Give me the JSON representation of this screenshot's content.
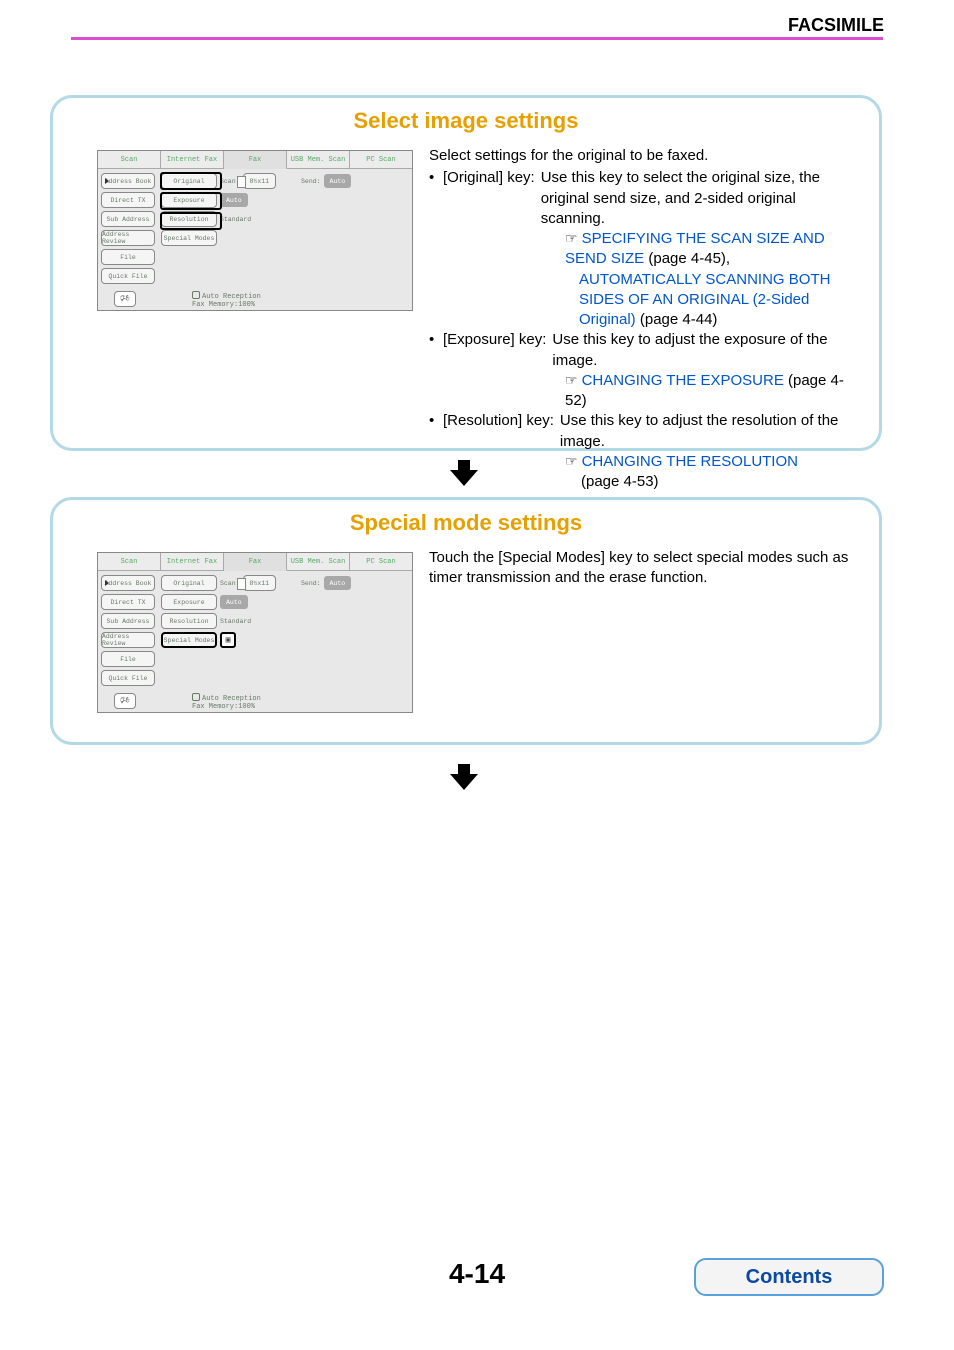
{
  "header": "FACSIMILE",
  "page_number": "4-14",
  "contents_button": "Contents",
  "tabs": [
    "Scan",
    "Internet Fax",
    "Fax",
    "USB Mem. Scan",
    "PC Scan"
  ],
  "side": {
    "address_book": "Address Book",
    "direct_tx": "Direct TX",
    "sub_address": "Sub Address",
    "address_review": "Address Review",
    "file": "File",
    "quick_file": "Quick File"
  },
  "settings": {
    "original": "Original",
    "scan": "Scan:",
    "scan_val": "8½x11",
    "send": "Send:",
    "send_val": "Auto",
    "exposure": "Exposure",
    "exposure_val": "Auto",
    "resolution": "Resolution",
    "resolution_val": "Standard",
    "special_modes": "Special Modes"
  },
  "status": {
    "line1": "Auto Reception",
    "line2": "Fax Memory:100%"
  },
  "panel1": {
    "title": "Select image settings",
    "intro": "Select settings for the original to be faxed.",
    "orig_key": "[Original] key:",
    "orig_txt": "Use this key to select the original size, the original send size, and 2-sided original scanning.",
    "link1": "SPECIFYING THE SCAN SIZE AND SEND SIZE",
    "link1_pg": " (page 4-45), ",
    "link2": "AUTOMATICALLY SCANNING BOTH SIDES OF AN ORIGINAL (2-Sided Original)",
    "link2_pg": " (page 4-44)",
    "exp_key": "[Exposure] key:",
    "exp_txt": "Use this key to adjust the exposure of the image.",
    "link3": "CHANGING THE EXPOSURE",
    "link3_pg": " (page 4-52)",
    "res_key": "[Resolution] key:",
    "res_txt": "Use this key to adjust the resolution of the image.",
    "link4": "CHANGING THE RESOLUTION",
    "link4_pg": "(page 4-53)"
  },
  "panel2": {
    "title": "Special mode settings",
    "text": "Touch the [Special Modes] key to select special modes such as timer transmission and the erase function."
  }
}
